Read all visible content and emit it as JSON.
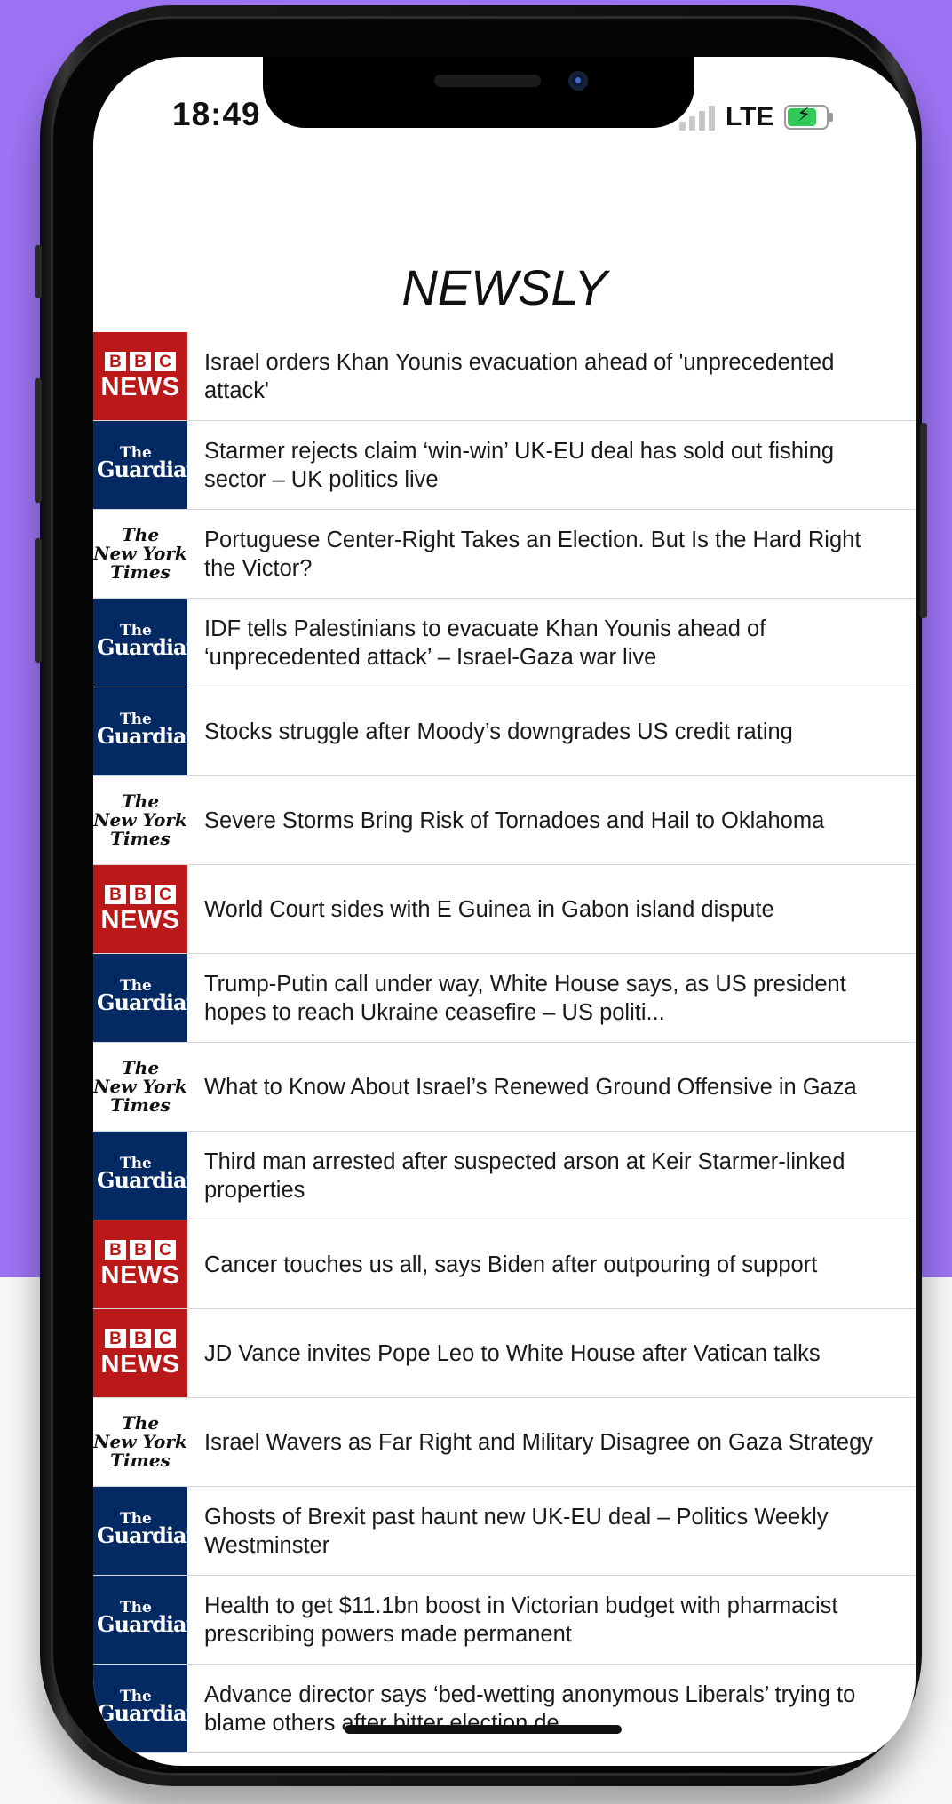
{
  "status_bar": {
    "time": "18:49",
    "network": "LTE",
    "battery_icon": "battery-charging-icon",
    "signal_icon": "signal-bars-icon"
  },
  "app": {
    "title": "NEWSLY"
  },
  "colors": {
    "background_top": "#9d74f5",
    "bbc_red": "#bb1919",
    "guardian_blue": "#052962"
  },
  "sources": {
    "bbc": {
      "letters": [
        "B",
        "B",
        "C"
      ],
      "word": "NEWS"
    },
    "guardian": {
      "small": "The",
      "big": "Guardian"
    },
    "nyt": {
      "line1": "The",
      "line2": "New York",
      "line3": "Times"
    }
  },
  "news": [
    {
      "source": "bbc",
      "headline": "Israel orders Khan Younis evacuation ahead of 'unprecedented attack'"
    },
    {
      "source": "guardian",
      "headline": "Starmer rejects claim ‘win-win’ UK-EU deal has sold out fishing sector – UK politics live"
    },
    {
      "source": "nyt",
      "headline": "Portuguese Center-Right Takes an Election. But Is the Hard Right the Victor?"
    },
    {
      "source": "guardian",
      "headline": "IDF tells Palestinians to evacuate Khan Younis ahead of ‘unprecedented attack’ – Israel-Gaza war live"
    },
    {
      "source": "guardian",
      "headline": "Stocks struggle after Moody’s downgrades US credit rating"
    },
    {
      "source": "nyt",
      "headline": "Severe Storms Bring Risk of Tornadoes and Hail to Oklahoma"
    },
    {
      "source": "bbc",
      "headline": "World Court sides with E Guinea in Gabon island dispute"
    },
    {
      "source": "guardian",
      "headline": "Trump-Putin call under way, White House says, as US president hopes to reach Ukraine ceasefire – US politi..."
    },
    {
      "source": "nyt",
      "headline": "What to Know About Israel’s Renewed Ground Offensive in Gaza"
    },
    {
      "source": "guardian",
      "headline": "Third man arrested after suspected arson at Keir Starmer-linked properties"
    },
    {
      "source": "bbc",
      "headline": "Cancer touches us all, says Biden after outpouring of support"
    },
    {
      "source": "bbc",
      "headline": "JD Vance invites Pope Leo to White House after Vatican talks"
    },
    {
      "source": "nyt",
      "headline": "Israel Wavers as Far Right and Military Disagree on Gaza Strategy"
    },
    {
      "source": "guardian",
      "headline": "Ghosts of Brexit past haunt new UK-EU deal – Politics Weekly Westminster"
    },
    {
      "source": "guardian",
      "headline": "Health to get $11.1bn boost in Victorian budget with pharmacist prescribing powers made permanent"
    },
    {
      "source": "guardian",
      "headline": "Advance director says ‘bed-wetting anonymous Liberals’ trying to blame others after bitter election de..."
    }
  ]
}
